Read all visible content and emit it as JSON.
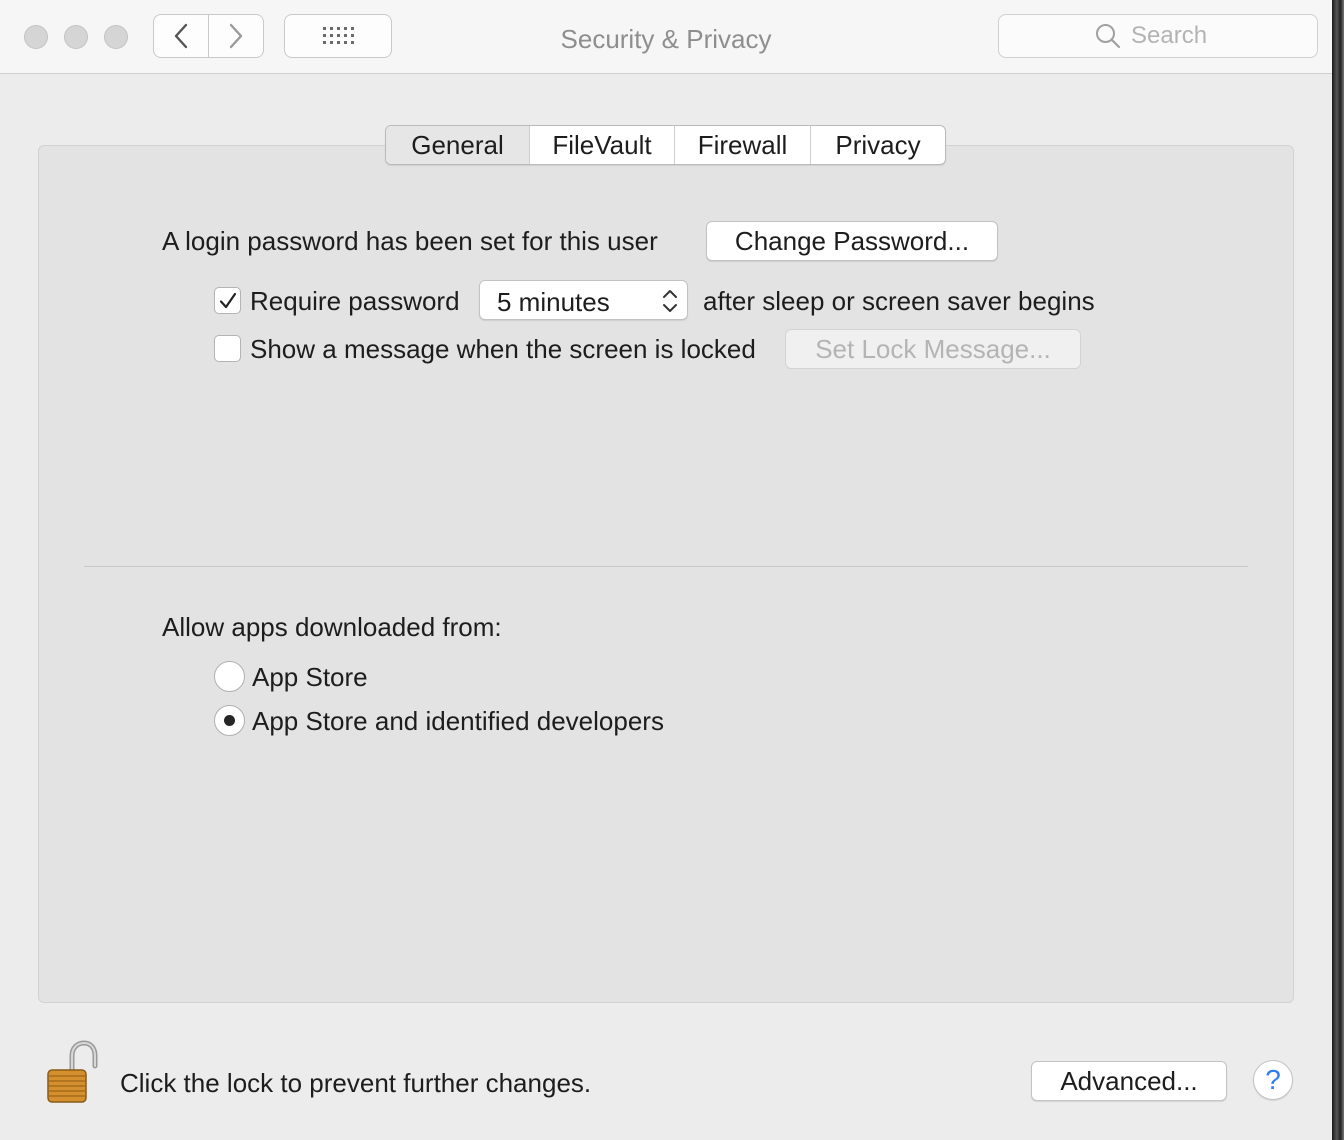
{
  "window": {
    "title": "Security & Privacy",
    "search": {
      "placeholder": "Search"
    }
  },
  "tabs": [
    {
      "label": "General",
      "selected": true
    },
    {
      "label": "FileVault",
      "selected": false
    },
    {
      "label": "Firewall",
      "selected": false
    },
    {
      "label": "Privacy",
      "selected": false
    }
  ],
  "general": {
    "login_password_text": "A login password has been set for this user",
    "change_password_label": "Change Password...",
    "require_password": {
      "label": "Require password",
      "checked": true,
      "selected_delay": "5 minutes",
      "suffix": "after sleep or screen saver begins"
    },
    "lock_message": {
      "label": "Show a message when the screen is locked",
      "checked": false,
      "button_label": "Set Lock Message..."
    },
    "allow_apps": {
      "heading": "Allow apps downloaded from:",
      "options": [
        {
          "label": "App Store",
          "selected": false
        },
        {
          "label": "App Store and identified developers",
          "selected": true
        }
      ]
    }
  },
  "footer": {
    "lock_text": "Click the lock to prevent further changes.",
    "advanced_label": "Advanced...",
    "help_label": "?"
  },
  "colors": {
    "window_bg": "#ececec",
    "panel_bg": "#e3e3e3",
    "help_accent": "#2f7df6",
    "lock_gold": "#d4902e"
  }
}
